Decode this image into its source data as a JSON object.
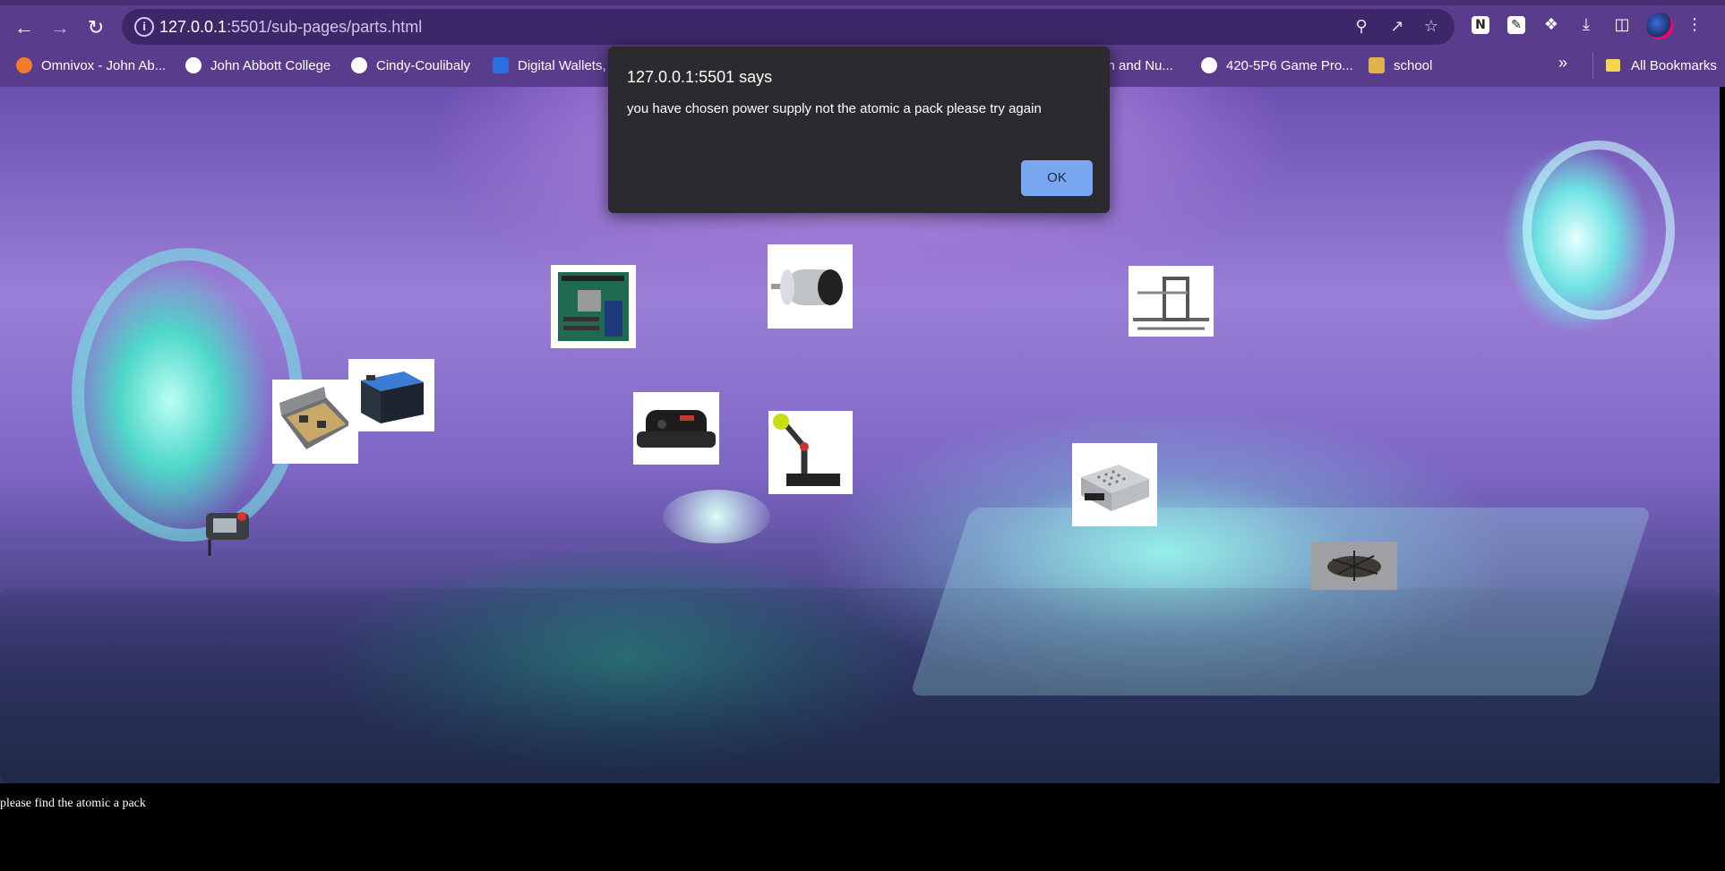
{
  "browser": {
    "url_host": "127.0.0.1",
    "url_path": ":5501/sub-pages/parts.html",
    "bookmarks": [
      {
        "label": "Omnivox - John Ab...",
        "icon": "omnivox-icon",
        "color": "#f07c2c"
      },
      {
        "label": "John Abbott College",
        "icon": "globe-icon",
        "color": "#ffffff"
      },
      {
        "label": "Cindy-Coulibaly",
        "icon": "github-icon",
        "color": "#ffffff"
      },
      {
        "label": "Digital Wallets,",
        "icon": "paypal-icon",
        "color": "#2c6fe0"
      },
      {
        "label": "lth and Nu...",
        "icon": "bookmark-icon",
        "color": "#ffffff"
      },
      {
        "label": "420-5P6 Game Pro...",
        "icon": "globe-icon",
        "color": "#ffffff"
      },
      {
        "label": "school",
        "icon": "crown-icon",
        "color": "#e0b24a"
      }
    ],
    "overflow": "»",
    "all_bookmarks": "All Bookmarks"
  },
  "dialog": {
    "title": "127.0.0.1:5501 says",
    "message": "you have chosen power supply not the atomic a pack please try again",
    "ok_label": "OK"
  },
  "page": {
    "instruction": "please find the atomic a pack",
    "parts": [
      {
        "id": "motherboard"
      },
      {
        "id": "electric-motor"
      },
      {
        "id": "linear-rail-frame"
      },
      {
        "id": "tool-kit-case"
      },
      {
        "id": "battery"
      },
      {
        "id": "sensor-module"
      },
      {
        "id": "robot-arm"
      },
      {
        "id": "power-supply"
      },
      {
        "id": "teach-pendant"
      },
      {
        "id": "mechanical-assembly"
      }
    ]
  }
}
